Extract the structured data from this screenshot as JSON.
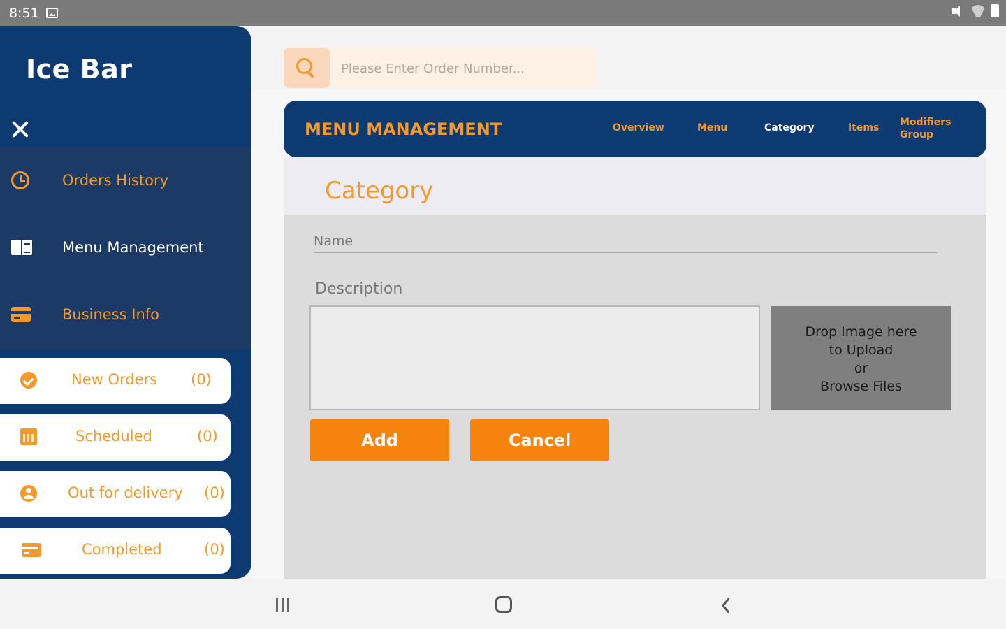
{
  "status_bar": {
    "time": "8:51"
  },
  "sidebar": {
    "brand": "Ice Bar",
    "nav": [
      {
        "label": "Orders History",
        "icon": "history-icon",
        "color": "#f39a2c"
      },
      {
        "label": "Menu Management",
        "icon": "book-icon",
        "color": "#ffffff"
      },
      {
        "label": "Business Info",
        "icon": "card-icon",
        "color": "#f39a2c"
      }
    ],
    "orders": [
      {
        "label": "New Orders",
        "count": "(0)",
        "icon": "badge-icon"
      },
      {
        "label": "Scheduled",
        "count": "(0)",
        "icon": "calendar-icon"
      },
      {
        "label": "Out for delivery",
        "count": "(0)",
        "icon": "person-icon"
      },
      {
        "label": "Completed",
        "count": "(0)",
        "icon": "card-icon"
      }
    ]
  },
  "search": {
    "placeholder": "Please Enter Order Number..."
  },
  "header": {
    "title": "MENU MANAGEMENT",
    "tabs": [
      {
        "label": "Overview",
        "active": false
      },
      {
        "label": "Menu",
        "active": false
      },
      {
        "label": "Category",
        "active": true
      },
      {
        "label": "Items",
        "active": false
      },
      {
        "label": "Modifiers Group",
        "active": false
      }
    ]
  },
  "form": {
    "title": "Category",
    "name_label": "Name",
    "description_label": "Description",
    "drop_zone_lines": [
      "Drop Image here",
      "to Upload",
      "or",
      "Browse Files"
    ],
    "add_label": "Add",
    "cancel_label": "Cancel"
  },
  "colors": {
    "brand_blue": "#0e3a72",
    "accent_orange": "#f39a2c",
    "button_orange": "#f7830f"
  }
}
